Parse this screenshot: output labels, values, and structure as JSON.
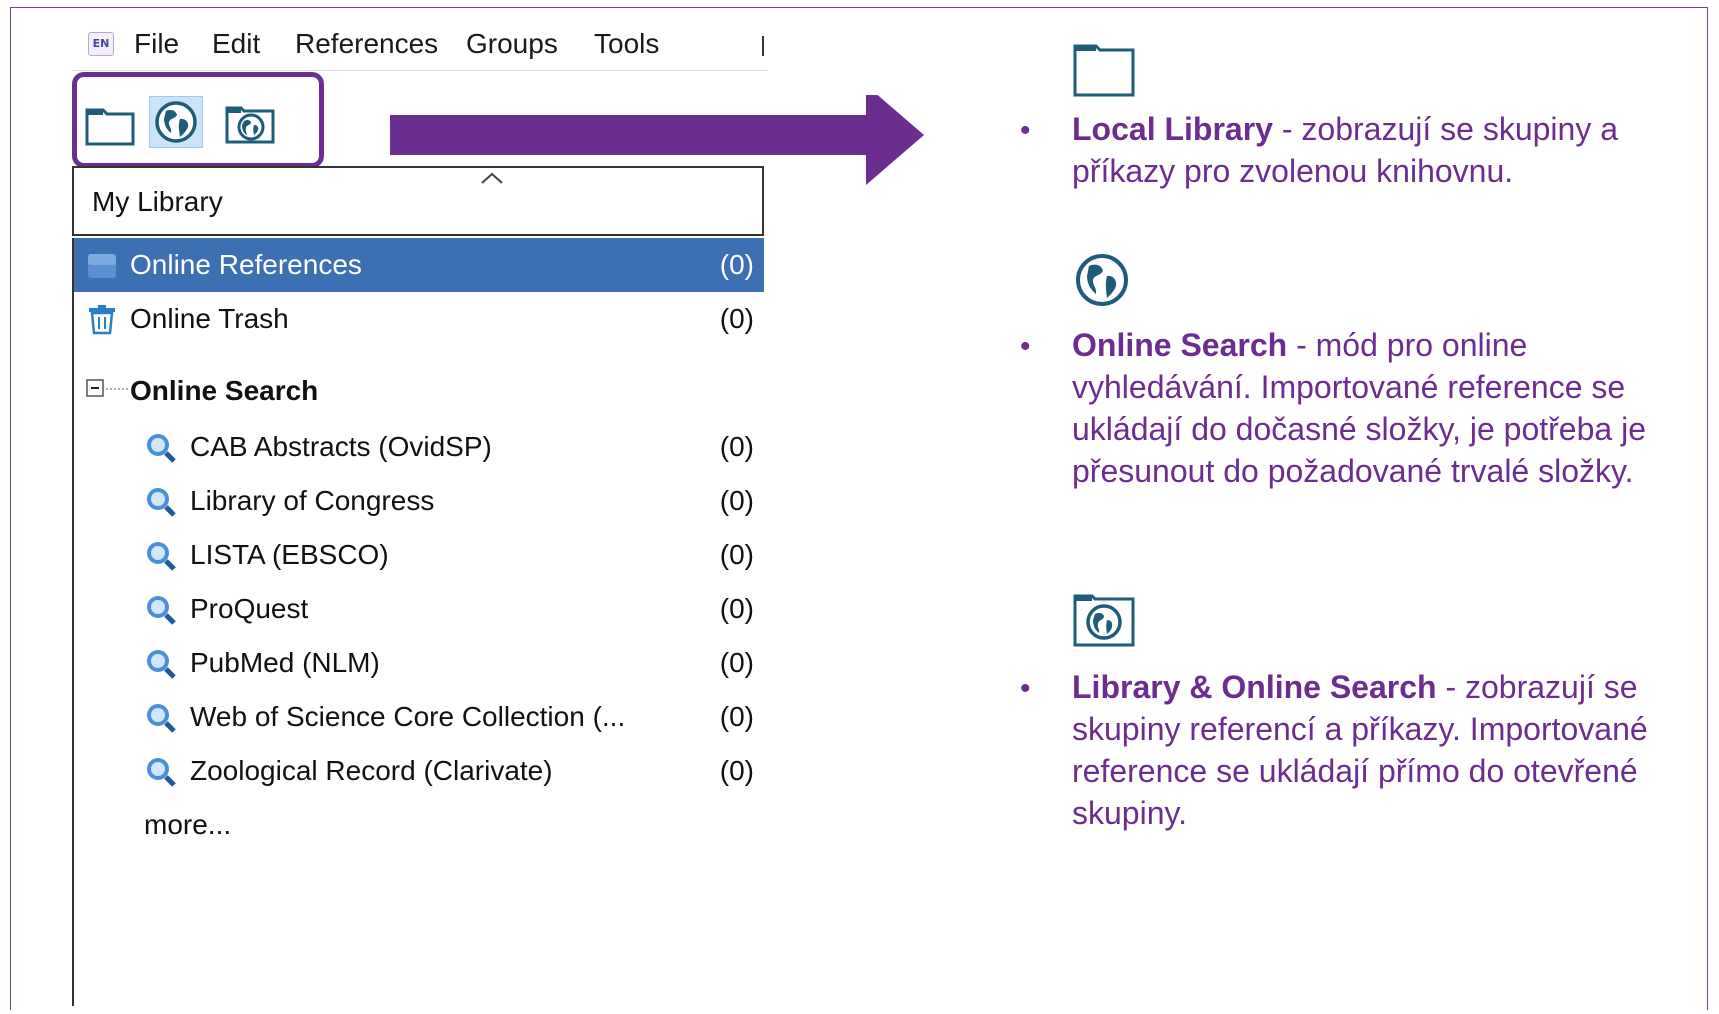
{
  "menubar": {
    "logo": "EN",
    "items": [
      "File",
      "Edit",
      "References",
      "Groups",
      "Tools"
    ]
  },
  "toolbar": {
    "modes": [
      "folder-icon",
      "globe-icon",
      "folder-globe-icon"
    ],
    "active_index": 1
  },
  "library_selector": {
    "label": "My Library"
  },
  "tree": {
    "online_references": {
      "label": "Online References",
      "count": "(0)"
    },
    "online_trash": {
      "label": "Online Trash",
      "count": "(0)"
    },
    "online_search_header": "Online Search",
    "sources": [
      {
        "label": "CAB Abstracts (OvidSP)",
        "count": "(0)"
      },
      {
        "label": "Library of Congress",
        "count": "(0)"
      },
      {
        "label": "LISTA (EBSCO)",
        "count": "(0)"
      },
      {
        "label": "ProQuest",
        "count": "(0)"
      },
      {
        "label": "PubMed (NLM)",
        "count": "(0)"
      },
      {
        "label": "Web of Science Core Collection (...",
        "count": "(0)"
      },
      {
        "label": "Zoological Record (Clarivate)",
        "count": "(0)"
      }
    ],
    "more": "more..."
  },
  "explanations": [
    {
      "title": "Local Library",
      "text": " - zobrazují se skupiny a příkazy pro zvolenou knihovnu."
    },
    {
      "title": "Online Search",
      "text": " - mód pro online vyhledávání. Importované reference se ukládají do dočasné složky, je potřeba je přesunout do požadované trvalé složky."
    },
    {
      "title": "Library & Online Search",
      "text": " - zobrazují se skupiny referencí a příkazy. Importované reference se ukládají přímo do otevřené skupiny."
    }
  ],
  "colors": {
    "accent_purple": "#6c2d91",
    "selection_blue": "#3d70b2",
    "icon_teal": "#1f5c7a"
  }
}
